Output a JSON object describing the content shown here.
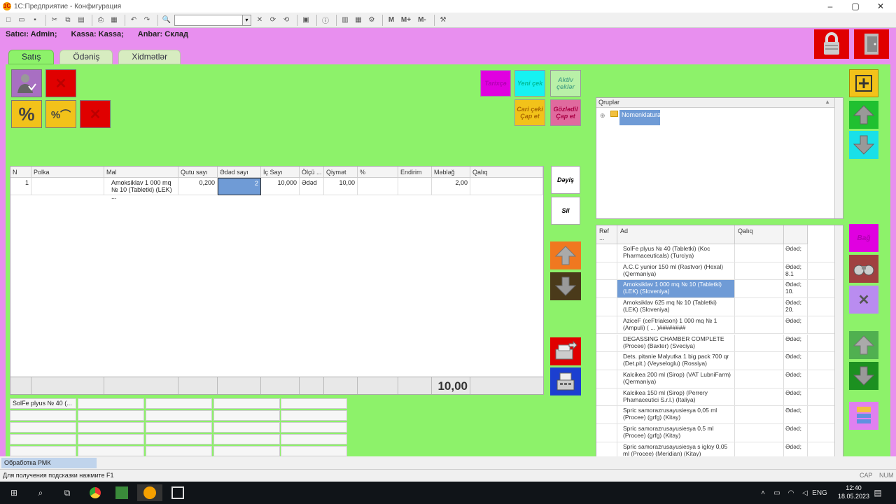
{
  "window": {
    "title": "1С:Предприятие - Конфигурация"
  },
  "info": {
    "seller": "Satıcı: Admin;",
    "kassa": "Kassa: Kassa;",
    "anbar": "Anbar: Склад"
  },
  "tabs": [
    "Satış",
    "Ödəniş",
    "Xidmətlər"
  ],
  "action_buttons": {
    "customer": "Tarixçə",
    "new_check": "Yeni çek",
    "active_checks": "Aktiv çeklər",
    "print_check": "Cari çeki Çap et",
    "postponed_check": "Gözlədil Çap et",
    "change": "Dəyiş",
    "delete": "Sil"
  },
  "cart": {
    "headers": [
      "N",
      "Polka",
      "Mal",
      "Qutu sayı",
      "Ədəd sayı",
      "İç Sayı",
      "Ölçü ...",
      "Qiymət",
      "%",
      "Endirim",
      "Məbləğ",
      "Qalıq"
    ],
    "rows": [
      {
        "n": "1",
        "polka": "",
        "mal": "Amoksiklav 1 000 mq № 10 (Tabletki) (LEK) ...",
        "qutu": "0,200",
        "eded": "2",
        "ic": "10,000",
        "olcu": "Ədəd",
        "qiymet": "10,00",
        "faiz": "",
        "endirim": "",
        "mebleg": "2,00",
        "qaliq": ""
      }
    ],
    "total": "10,00"
  },
  "quick_items": [
    "SolFe plyus № 40 (..."
  ],
  "groups": {
    "header": "Qruplar",
    "root": "Nomenklatura"
  },
  "products": {
    "headers": [
      "Ref ...",
      "Ad",
      "Qalıq",
      ""
    ],
    "rows": [
      {
        "name": "SolFe plyus № 40 (Tabletki) (Koc Pharmaceuticals) (Turciya)",
        "unit": "Ədəd;"
      },
      {
        "name": "A.C.C yunior 150 ml (Rastvor) (Hexal) (Qermaniya)",
        "unit": "Ədəd; 8.1"
      },
      {
        "name": "Amoksiklav 1 000 mq № 10 (Tabletki) (LEK) (Sloveniya)",
        "unit": "Ədəd; 10."
      },
      {
        "name": "Amoksiklav 625 mq № 10 (Tabletki) (LEK) (Sloveniya)",
        "unit": "Ədəd; 20."
      },
      {
        "name": "AziceF (ceFtriakson) 1 000 mq № 1 (Ampuli) ( ... )########",
        "unit": "Ədəd;"
      },
      {
        "name": "DEGASSING CHAMBER COMPLETE (Procee) (Baxter) (Sveciya)",
        "unit": "Ədəd;"
      },
      {
        "name": "Dets. pitanie Malyutka 1 big pack 700 qr (Det.pit.) (Veyseloglu) (Rossiya)",
        "unit": "Ədəd;"
      },
      {
        "name": "Kalcikeа 200 ml (Sirop) (VAT LubniFarm) (Qermaniya)",
        "unit": "Ədəd;"
      },
      {
        "name": "Kalcikea 150 ml (Sirop) (Perrery Phamaceutici S.r.l.) (Italiya)",
        "unit": "Ədəd;"
      },
      {
        "name": "Spric samorazrusayusiesya 0,05 ml (Procee) (grfg) (Kitay)",
        "unit": "Ədəd;"
      },
      {
        "name": "Spric samorazrusayusiesya 0,5 ml (Procee) (grfg) (Kitay)",
        "unit": "Ədəd;"
      },
      {
        "name": "Spric samorazrusayusiesya s igloy 0,05 ml (Procee) (Meridian) (Kitay)",
        "unit": "Ədəd;"
      },
      {
        "name": "Spric samorazrusayusiesya s igloy 0,05",
        "unit": "Ədəd;"
      }
    ]
  },
  "side_buttons": {
    "bag": "Bağ"
  },
  "status": {
    "process": "Обработка  РМК",
    "hint": "Для получения подсказки нажмите F1",
    "cap": "CAP",
    "num": "NUM"
  },
  "taskbar": {
    "lang": "ENG",
    "time": "12:40",
    "date": "18.05.2023"
  },
  "colors": {
    "panel": "#8df26a",
    "header": "#e88fef",
    "selection": "#6f9bd6",
    "danger": "#e00000"
  }
}
